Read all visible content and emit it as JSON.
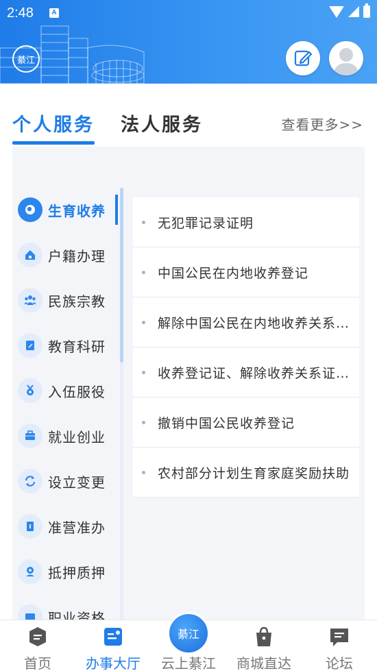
{
  "status_bar": {
    "time": "2:48",
    "notification": "A"
  },
  "header": {
    "logo_text": "綦江"
  },
  "tabs": [
    {
      "label": "个人服务",
      "active": true
    },
    {
      "label": "法人服务",
      "active": false
    }
  ],
  "more_link": "查看更多>>",
  "categories": [
    {
      "label": "生育收养",
      "icon": "baby-icon",
      "active": true
    },
    {
      "label": "户籍办理",
      "icon": "home-icon",
      "active": false
    },
    {
      "label": "民族宗教",
      "icon": "people-icon",
      "active": false
    },
    {
      "label": "教育科研",
      "icon": "book-icon",
      "active": false
    },
    {
      "label": "入伍服役",
      "icon": "medal-icon",
      "active": false
    },
    {
      "label": "就业创业",
      "icon": "briefcase-icon",
      "active": false
    },
    {
      "label": "设立变更",
      "icon": "refresh-icon",
      "active": false
    },
    {
      "label": "准营准办",
      "icon": "permit-icon",
      "active": false
    },
    {
      "label": "抵押质押",
      "icon": "pledge-icon",
      "active": false
    },
    {
      "label": "职业资格",
      "icon": "certificate-icon",
      "active": false
    }
  ],
  "services": [
    "无犯罪记录证明",
    "中国公民在内地收养登记",
    "解除中国公民在内地收养关系登记",
    "收养登记证、解除收养关系证明补领",
    "撤销中国公民收养登记",
    "农村部分计划生育家庭奖励扶助"
  ],
  "bottom_nav": [
    {
      "label": "首页",
      "icon": "chat-icon",
      "active": false
    },
    {
      "label": "办事大厅",
      "icon": "hall-icon",
      "active": true
    },
    {
      "label": "云上綦江",
      "icon": "qijiang-logo-icon",
      "active": false
    },
    {
      "label": "商城直达",
      "icon": "shopping-bag-icon",
      "active": false
    },
    {
      "label": "论坛",
      "icon": "forum-icon",
      "active": false
    }
  ],
  "colors": {
    "primary": "#1f7ce8",
    "panel_bg": "#f3f5f9",
    "text": "#333333"
  }
}
